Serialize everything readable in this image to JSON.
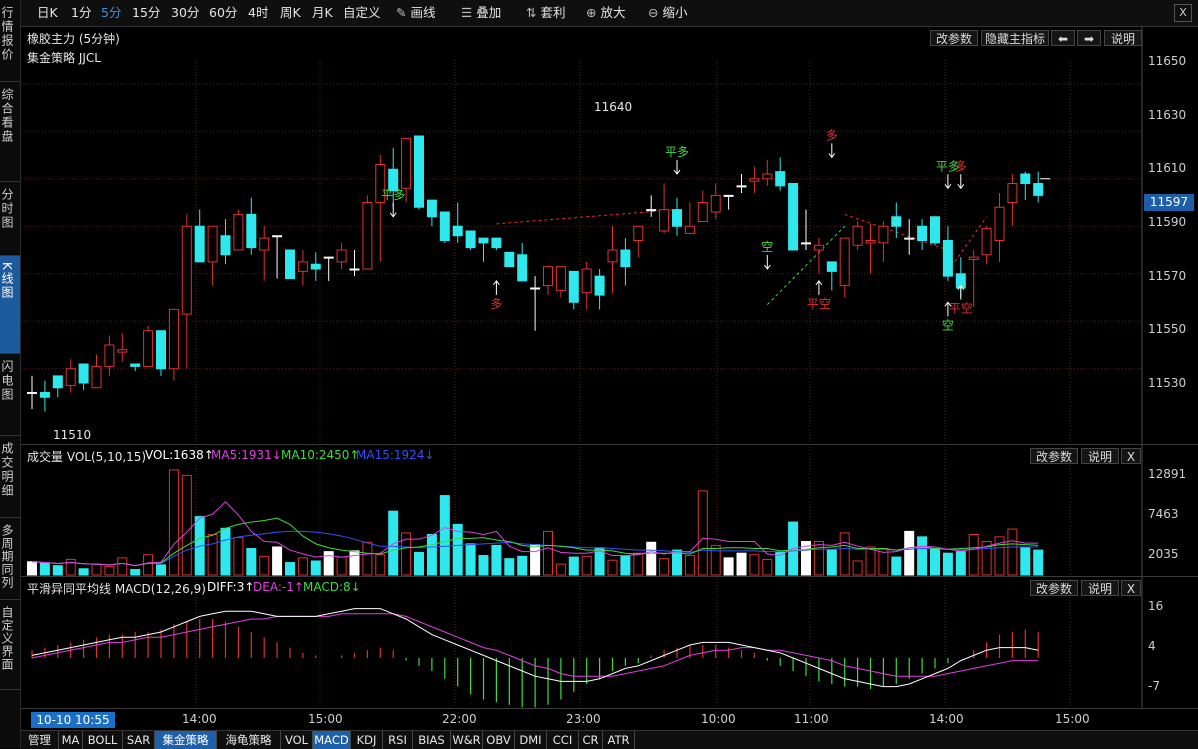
{
  "sidebar": {
    "items": [
      {
        "label": "行情报价"
      },
      {
        "label": "综合看盘"
      },
      {
        "label": "分时图"
      },
      {
        "label": "K线图"
      },
      {
        "label": "闪电图"
      },
      {
        "label": "成交明细"
      },
      {
        "label": "多周期同列"
      },
      {
        "label": "自定义界面"
      }
    ]
  },
  "toolbar": {
    "periods": [
      "日K",
      "1分",
      "5分",
      "15分",
      "30分",
      "60分",
      "4时",
      "周K",
      "月K",
      "自定义"
    ],
    "active_period": "5分",
    "tools": [
      {
        "icon": "pen-icon",
        "label": "画线"
      },
      {
        "icon": "stack-icon",
        "label": "叠加"
      },
      {
        "icon": "arbitrage-icon",
        "label": "套利"
      },
      {
        "icon": "zoom-in-icon",
        "label": "放大"
      },
      {
        "icon": "zoom-out-icon",
        "label": "缩小"
      }
    ],
    "close": "X"
  },
  "main_panel": {
    "title": "橡胶主力 (5分钟)",
    "strategy": "集金策略 JJCL",
    "buttons": {
      "params": "改参数",
      "hide": "隐藏主指标",
      "left": "⬅",
      "right": "➡",
      "help": "说明"
    },
    "price_labels": [
      "11650",
      "11630",
      "11610",
      "11590",
      "11570",
      "11550",
      "11530"
    ],
    "current_price": "11597",
    "high_label": "11640",
    "low_label": "11510"
  },
  "volume_panel": {
    "title": "成交量 VOL(5,10,15)",
    "vol": "VOL:1638↑",
    "ma5": "MA5:1931↓",
    "ma10": "MA10:2450↑",
    "ma15": "MA15:1924↓",
    "labels": [
      "12891",
      "7463",
      "2035"
    ],
    "buttons": {
      "params": "改参数",
      "help": "说明",
      "close": "X"
    }
  },
  "macd_panel": {
    "title": "平滑异同平均线 MACD(12,26,9)",
    "diff": "DIFF:3↑",
    "dea": "DEA:-1↑",
    "macd": "MACD:8↓",
    "labels": [
      "16",
      "4",
      "-7"
    ],
    "buttons": {
      "params": "改参数",
      "help": "说明",
      "close": "X"
    }
  },
  "time_axis": {
    "cursor": "10-10 10:55",
    "labels": [
      "14:00",
      "15:00",
      "22:00",
      "23:00",
      "10:00",
      "11:00",
      "14:00",
      "15:00"
    ]
  },
  "bottom_tabs": {
    "items": [
      "管理",
      "MA",
      "BOLL",
      "SAR",
      "集金策略",
      "海龟策略",
      "VOL",
      "MACD",
      "KDJ",
      "RSI",
      "BIAS",
      "W&R",
      "OBV",
      "DMI",
      "CCI",
      "CR",
      "ATR"
    ],
    "active": [
      "集金策略",
      "MACD"
    ]
  },
  "signals": [
    {
      "text": "平多",
      "dir": "down",
      "color": "#3ddc3d",
      "c": 28,
      "price": 11594
    },
    {
      "text": "多",
      "dir": "up",
      "color": "#e03030",
      "c": 36,
      "price": 11567
    },
    {
      "text": "平多",
      "dir": "down",
      "color": "#3ddc3d",
      "c": 50,
      "price": 11612
    },
    {
      "text": "空",
      "dir": "down",
      "color": "#3ddc3d",
      "c": 57,
      "price": 11572
    },
    {
      "text": "平空",
      "dir": "up",
      "color": "#e03030",
      "c": 61,
      "price": 11567
    },
    {
      "text": "多",
      "dir": "down",
      "color": "#e03030",
      "c": 62,
      "price": 11619
    },
    {
      "text": "平多",
      "dir": "down",
      "color": "#3ddc3d",
      "c": 71,
      "price": 11606
    },
    {
      "text": "多",
      "dir": "down",
      "color": "#e03030",
      "c": 72,
      "price": 11606
    },
    {
      "text": "空",
      "dir": "up",
      "color": "#3ddc3d",
      "c": 71,
      "price": 11558
    },
    {
      "text": "平空",
      "dir": "up",
      "color": "#e03030",
      "c": 72,
      "price": 11565
    }
  ],
  "colors": {
    "up": "#e03030",
    "down": "#2ee8ee",
    "diff": "#ffffff",
    "dea": "#e040e0",
    "ma5": "#e040e0",
    "ma10": "#3ddc3d",
    "ma15": "#3050ff",
    "grid": "#5a1a1a"
  },
  "chart_data": {
    "type": "candlestick",
    "price_range": [
      11500,
      11660
    ],
    "candles": [
      [
        11520,
        11527,
        11513,
        11520
      ],
      [
        11520,
        11525,
        11512,
        11518
      ],
      [
        11527,
        11527,
        11518,
        11522
      ],
      [
        11523,
        11534,
        11520,
        11530
      ],
      [
        11532,
        11532,
        11521,
        11524
      ],
      [
        11522,
        11536,
        11522,
        11531
      ],
      [
        11531,
        11544,
        11527,
        11540
      ],
      [
        11537,
        11545,
        11533,
        11538
      ],
      [
        11532,
        11532,
        11529,
        11531
      ],
      [
        11531,
        11548,
        11531,
        11546
      ],
      [
        11546,
        11546,
        11527,
        11530
      ],
      [
        11530,
        11555,
        11525,
        11555
      ],
      [
        11553,
        11595,
        11530,
        11590
      ],
      [
        11590,
        11597,
        11575,
        11575
      ],
      [
        11575,
        11590,
        11565,
        11590
      ],
      [
        11586,
        11593,
        11574,
        11578
      ],
      [
        11580,
        11597,
        11580,
        11595
      ],
      [
        11595,
        11602,
        11578,
        11581
      ],
      [
        11580,
        11590,
        11567,
        11585
      ],
      [
        11586,
        11586,
        11568,
        11586
      ],
      [
        11580,
        11580,
        11568,
        11568
      ],
      [
        11571,
        11580,
        11565,
        11575
      ],
      [
        11574,
        11579,
        11567,
        11572
      ],
      [
        11577,
        11577,
        11567,
        11577
      ],
      [
        11575,
        11583,
        11572,
        11580
      ],
      [
        11572,
        11580,
        11569,
        11572
      ],
      [
        11572,
        11603,
        11572,
        11600
      ],
      [
        11600,
        11620,
        11575,
        11616
      ],
      [
        11614,
        11623,
        11598,
        11605
      ],
      [
        11606,
        11627,
        11600,
        11627
      ],
      [
        11628,
        11628,
        11597,
        11598
      ],
      [
        11601,
        11601,
        11590,
        11594
      ],
      [
        11596,
        11596,
        11583,
        11584
      ],
      [
        11590,
        11600,
        11583,
        11586
      ],
      [
        11588,
        11588,
        11580,
        11581
      ],
      [
        11585,
        11585,
        11575,
        11583
      ],
      [
        11585,
        11585,
        11580,
        11581
      ],
      [
        11579,
        11579,
        11573,
        11573
      ],
      [
        11578,
        11583,
        11568,
        11567
      ],
      [
        11564,
        11569,
        11546,
        11564
      ],
      [
        11565,
        11573,
        11561,
        11573
      ],
      [
        11563,
        11573,
        11560,
        11573
      ],
      [
        11571,
        11571,
        11555,
        11558
      ],
      [
        11562,
        11575,
        11555,
        11572
      ],
      [
        11569,
        11572,
        11555,
        11561
      ],
      [
        11575,
        11590,
        11562,
        11580
      ],
      [
        11580,
        11585,
        11565,
        11573
      ],
      [
        11584,
        11590,
        11577,
        11590
      ],
      [
        11597,
        11603,
        11594,
        11597
      ],
      [
        11588,
        11608,
        11587,
        11597
      ],
      [
        11597,
        11602,
        11586,
        11590
      ],
      [
        11587,
        11600,
        11590,
        11590
      ],
      [
        11592,
        11605,
        11592,
        11600
      ],
      [
        11596,
        11608,
        11593,
        11603
      ],
      [
        11603,
        11603,
        11597,
        11603
      ],
      [
        11607,
        11612,
        11604,
        11607
      ],
      [
        11609,
        11615,
        11604,
        11610
      ],
      [
        11610,
        11618,
        11607,
        11612
      ],
      [
        11613,
        11619,
        11605,
        11607
      ],
      [
        11608,
        11608,
        11580,
        11580
      ],
      [
        11583,
        11597,
        11580,
        11583
      ],
      [
        11580,
        11585,
        11570,
        11582
      ],
      [
        11575,
        11575,
        11563,
        11571
      ],
      [
        11565,
        11585,
        11560,
        11585
      ],
      [
        11582,
        11592,
        11580,
        11590
      ],
      [
        11583,
        11591,
        11570,
        11584
      ],
      [
        11583,
        11592,
        11575,
        11590
      ],
      [
        11594,
        11600,
        11585,
        11590
      ],
      [
        11585,
        11593,
        11578,
        11585
      ],
      [
        11590,
        11593,
        11580,
        11584
      ],
      [
        11594,
        11594,
        11582,
        11583
      ],
      [
        11584,
        11590,
        11567,
        11569
      ],
      [
        11570,
        11577,
        11560,
        11564
      ],
      [
        11576,
        11580,
        11556,
        11577
      ],
      [
        11578,
        11590,
        11574,
        11589
      ],
      [
        11584,
        11604,
        11575,
        11598
      ],
      [
        11600,
        11612,
        11590,
        11608
      ],
      [
        11612,
        11613,
        11601,
        11608
      ],
      [
        11608,
        11613,
        11600,
        11603
      ]
    ],
    "volume": [
      1700,
      1500,
      1200,
      2000,
      800,
      1400,
      1100,
      2200,
      700,
      2600,
      1300,
      13500,
      12800,
      7500,
      5200,
      6000,
      4800,
      3400,
      2400,
      3600,
      1600,
      2200,
      1800,
      3000,
      2300,
      3100,
      4200,
      2600,
      8200,
      5400,
      2900,
      5200,
      10200,
      6500,
      4000,
      2500,
      3800,
      2100,
      2400,
      3900,
      5600,
      1400,
      2300,
      2400,
      3500,
      1900,
      2500,
      2800,
      4200,
      2100,
      3200,
      2500,
      10800,
      3800,
      2200,
      2800,
      2600,
      2000,
      2900,
      6800,
      4300,
      4300,
      3200,
      5400,
      1800,
      3600,
      3400,
      2300,
      5600,
      4900,
      3400,
      2800,
      3000,
      5200,
      4300,
      4900,
      5900,
      3500,
      3200
    ],
    "ma5": [
      1700,
      1600,
      1470,
      1600,
      1440,
      1380,
      1300,
      1500,
      1200,
      1560,
      1640,
      3950,
      5500,
      7300,
      7800,
      9400,
      7700,
      5600,
      4300,
      4200,
      3200,
      2700,
      2300,
      2500,
      2300,
      2500,
      2700,
      2800,
      4000,
      4600,
      4600,
      5100,
      6100,
      5600,
      5500,
      5200,
      5600,
      3700,
      3000,
      3000,
      3500,
      2900,
      2800,
      2800,
      3100,
      2500,
      2500,
      2600,
      3000,
      2700,
      3000,
      3000,
      4700,
      4600,
      4300,
      4300,
      4300,
      2700,
      2500,
      3400,
      3700,
      3900,
      3800,
      4200,
      3700,
      3300,
      2900,
      3000,
      3500,
      3700,
      3600,
      3300,
      3100,
      3300,
      3700,
      4100,
      4400,
      4100,
      4100
    ],
    "ma10": [
      1700,
      1600,
      1470,
      1600,
      1440,
      1380,
      1300,
      1500,
      1200,
      1500,
      1550,
      2800,
      3800,
      4700,
      5100,
      6000,
      6500,
      6800,
      7000,
      7300,
      6500,
      5000,
      4000,
      3500,
      3200,
      3000,
      2800,
      2700,
      3200,
      3500,
      3600,
      3900,
      4300,
      4700,
      4700,
      4800,
      4500,
      4300,
      3800,
      3600,
      3800,
      3700,
      3500,
      3200,
      3200,
      3100,
      2800,
      2700,
      2800,
      2800,
      2800,
      2700,
      3400,
      3400,
      3500,
      3500,
      3400,
      3400,
      3100,
      3200,
      3300,
      3500,
      3600,
      3800,
      3400,
      3400,
      3400,
      3200,
      3500,
      3600,
      3400,
      3300,
      3400,
      3500,
      3600,
      3900,
      4000,
      3900,
      3800
    ],
    "ma15": [
      1700,
      1600,
      1470,
      1600,
      1440,
      1380,
      1300,
      1500,
      1200,
      1500,
      1500,
      2400,
      3200,
      3700,
      4000,
      4500,
      4900,
      5100,
      5300,
      5500,
      5600,
      5600,
      5500,
      5300,
      5000,
      4600,
      4100,
      3700,
      3700,
      3600,
      3500,
      3600,
      3700,
      3800,
      3900,
      4000,
      4100,
      4200,
      4000,
      3900,
      3800,
      3700,
      3600,
      3500,
      3500,
      3400,
      3300,
      3200,
      3200,
      3100,
      3000,
      2900,
      3200,
      3100,
      3100,
      3100,
      3100,
      3000,
      3000,
      3100,
      3200,
      3300,
      3300,
      3400,
      3300,
      3300,
      3300,
      3200,
      3300,
      3400,
      3400,
      3300,
      3300,
      3300,
      3400,
      3500,
      3600,
      3600,
      3600
    ],
    "macd_hist": [
      3,
      4,
      5,
      6,
      7,
      8,
      9,
      9,
      10,
      10,
      11,
      13,
      14,
      15,
      15,
      14,
      12,
      10,
      8,
      6,
      4,
      2,
      1,
      0,
      1,
      2,
      3,
      4,
      3,
      -1,
      -3,
      -5,
      -8,
      -11,
      -14,
      -16,
      -17,
      -18,
      -19,
      -19,
      -18,
      -16,
      -13,
      -10,
      -8,
      -5,
      -3,
      -2,
      1,
      3,
      4,
      5,
      5,
      5,
      4,
      3,
      2,
      -1,
      -3,
      -5,
      -7,
      -9,
      -10,
      -11,
      -11,
      -12,
      -11,
      -10,
      -8,
      -6,
      -4,
      -2,
      0,
      3,
      6,
      9,
      10,
      11,
      10
    ],
    "diff": [
      1,
      2,
      3,
      4,
      5,
      6,
      7,
      8,
      8,
      9,
      10,
      12,
      14,
      16,
      17,
      18,
      18,
      18,
      17,
      16,
      16,
      16,
      16,
      17,
      18,
      19,
      19,
      19,
      17,
      15,
      12,
      9,
      7,
      5,
      3,
      1,
      -1,
      -3,
      -5,
      -7,
      -8,
      -9,
      -9,
      -9,
      -8,
      -6,
      -4,
      -3,
      -1,
      1,
      3,
      5,
      6,
      6,
      6,
      5,
      4,
      3,
      2,
      0,
      -2,
      -4,
      -6,
      -8,
      -9,
      -10,
      -11,
      -11,
      -10,
      -8,
      -6,
      -4,
      -1,
      1,
      3,
      4,
      4,
      4,
      3
    ],
    "dea": [
      0,
      1,
      2,
      3,
      4,
      5,
      6,
      6,
      7,
      8,
      8,
      9,
      10,
      11,
      12,
      13,
      14,
      15,
      15,
      16,
      16,
      16,
      16,
      16,
      17,
      17,
      17,
      17,
      17,
      16,
      14,
      12,
      10,
      8,
      6,
      4,
      3,
      1,
      -1,
      -3,
      -4,
      -6,
      -7,
      -7,
      -7,
      -7,
      -6,
      -5,
      -4,
      -3,
      -1,
      1,
      2,
      3,
      3,
      4,
      4,
      3,
      3,
      2,
      1,
      0,
      -1,
      -3,
      -4,
      -5,
      -6,
      -7,
      -7,
      -7,
      -7,
      -6,
      -5,
      -4,
      -3,
      -2,
      -1,
      -1,
      -1
    ]
  }
}
